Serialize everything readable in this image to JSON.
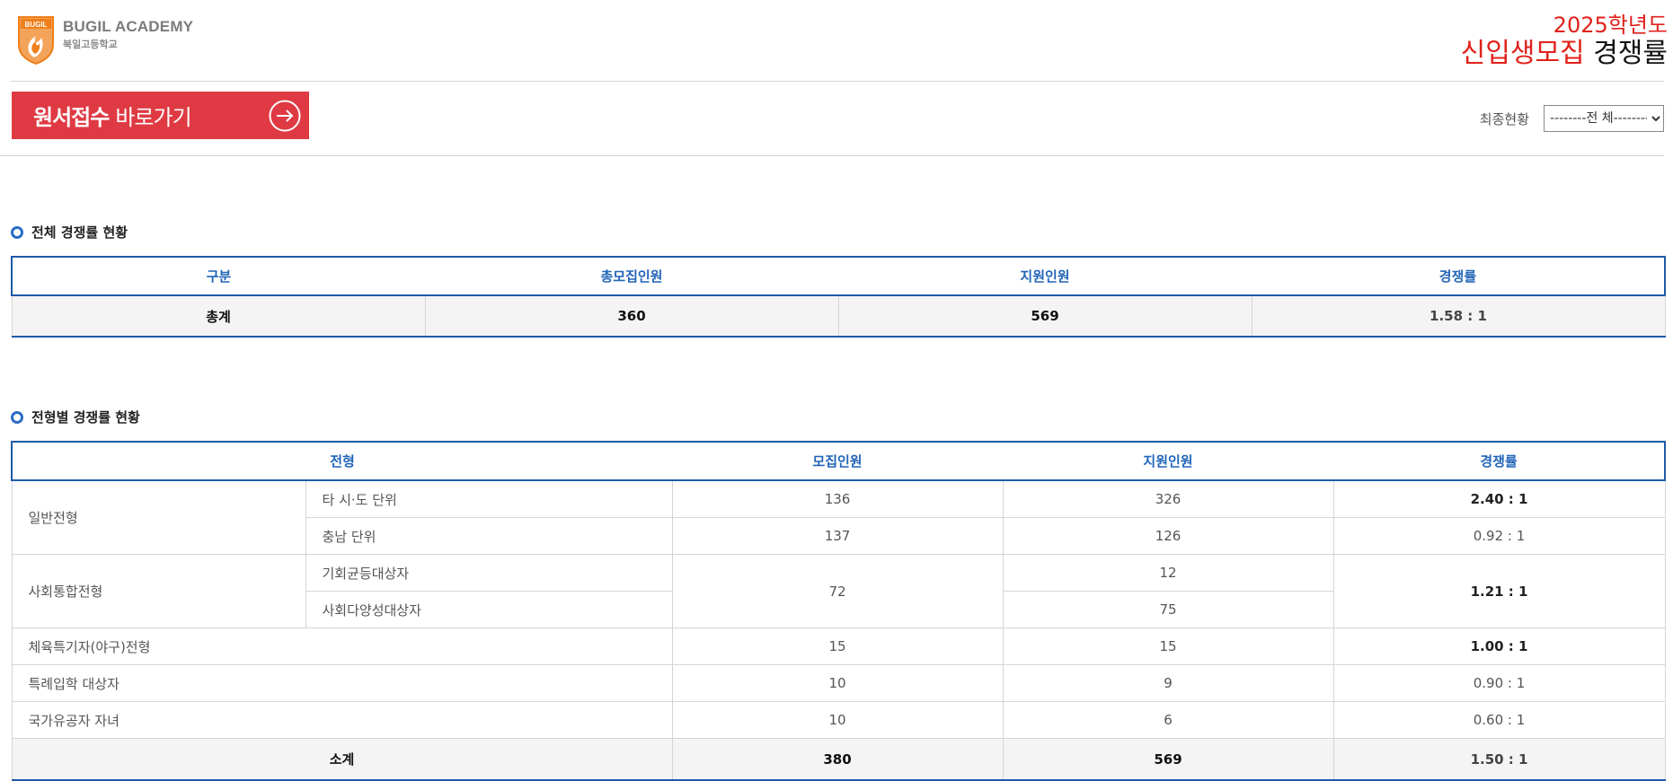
{
  "header": {
    "logo_en": "BUGIL ACADEMY",
    "logo_ko": "북일고등학교",
    "title_year": "2025학년도",
    "title_red": "신입생모집",
    "title_dark": "경쟁률"
  },
  "toolbar": {
    "apply_strong": "원서접수",
    "apply_rest": "바로가기",
    "filter_label": "최종현황",
    "filter_selected": "--------전 체--------"
  },
  "overall": {
    "section_title": "전체 경쟁률 현황",
    "headers": [
      "구분",
      "총모집인원",
      "지원인원",
      "경쟁률"
    ],
    "row": {
      "label": "총계",
      "quota": "360",
      "applicants": "569",
      "ratio": "1.58 : 1"
    }
  },
  "by_type": {
    "section_title": "전형별 경쟁률 현황",
    "headers": [
      "전형",
      "모집인원",
      "지원인원",
      "경쟁률"
    ],
    "general": {
      "label": "일반전형",
      "rows": [
        {
          "sub": "타 시·도 단위",
          "quota": "136",
          "applicants": "326",
          "ratio": "2.40 : 1"
        },
        {
          "sub": "충남 단위",
          "quota": "137",
          "applicants": "126",
          "ratio": "0.92 : 1"
        }
      ]
    },
    "social": {
      "label": "사회통합전형",
      "quota": "72",
      "ratio": "1.21 : 1",
      "rows": [
        {
          "sub": "기회균등대상자",
          "applicants": "12"
        },
        {
          "sub": "사회다양성대상자",
          "applicants": "75"
        }
      ]
    },
    "others": [
      {
        "label": "체육특기자(야구)전형",
        "quota": "15",
        "applicants": "15",
        "ratio": "1.00 : 1"
      },
      {
        "label": "특례입학 대상자",
        "quota": "10",
        "applicants": "9",
        "ratio": "0.90 : 1"
      },
      {
        "label": "국가유공자 자녀",
        "quota": "10",
        "applicants": "6",
        "ratio": "0.60 : 1"
      }
    ],
    "subtotal": {
      "label": "소계",
      "quota": "380",
      "applicants": "569",
      "ratio": "1.50 : 1"
    }
  }
}
